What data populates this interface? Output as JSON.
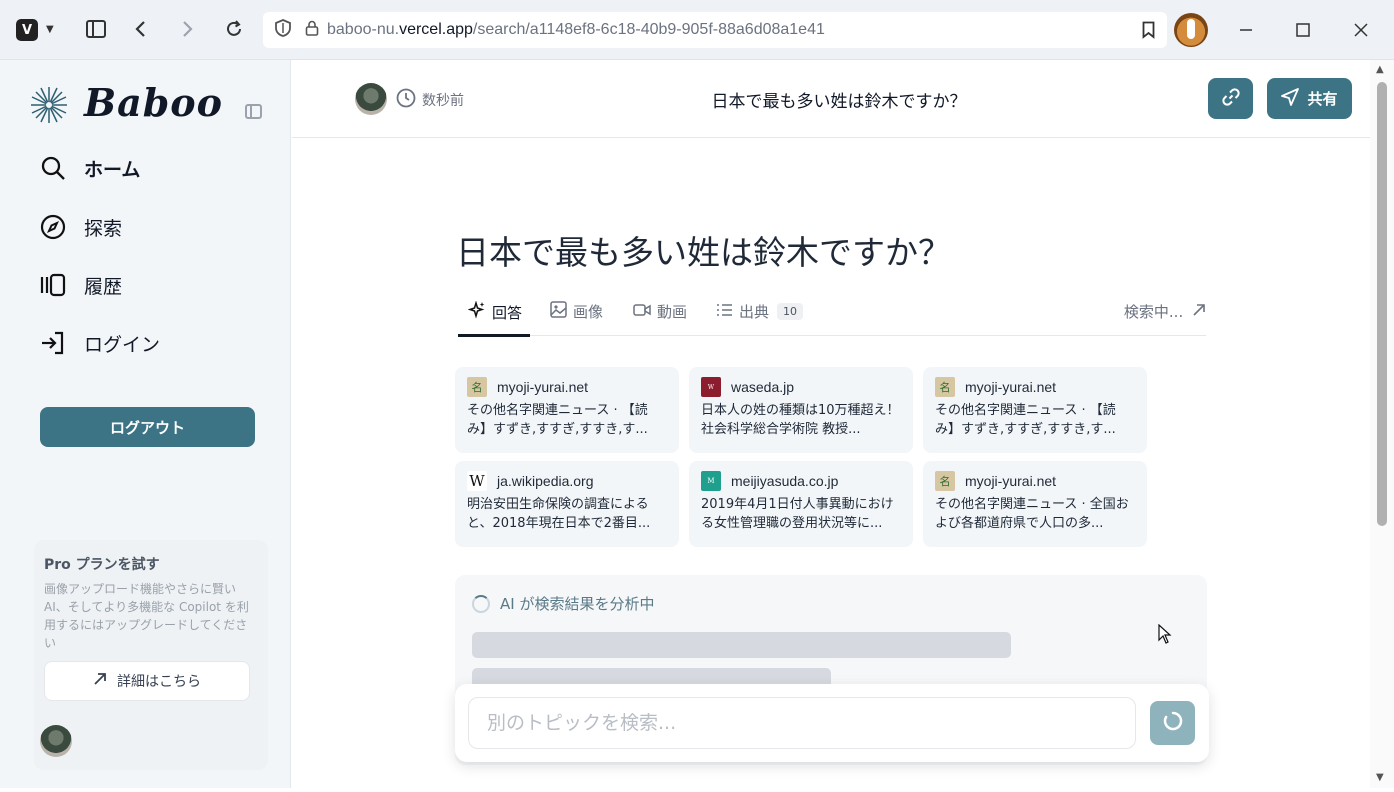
{
  "browser": {
    "url_prefix": "baboo-nu.",
    "url_host": "vercel.app",
    "url_path": "/search/a1148ef8-6c18-40b9-905f-88a6d08a1e41"
  },
  "sidebar": {
    "brand": "Baboo",
    "nav": [
      {
        "label": "ホーム",
        "icon": "search-icon"
      },
      {
        "label": "探索",
        "icon": "compass-icon"
      },
      {
        "label": "履歴",
        "icon": "history-icon"
      },
      {
        "label": "ログイン",
        "icon": "login-icon"
      }
    ],
    "logout_label": "ログアウト",
    "pro": {
      "title": "Pro プランを試す",
      "description": "画像アップロード機能やさらに賢い AI、そしてより多機能な Copilot を利用するにはアップグレードしてください",
      "button_label": "詳細はこちら"
    }
  },
  "header": {
    "time": "数秒前",
    "title": "日本で最も多い姓は鈴木ですか？",
    "share_label": "共有"
  },
  "main": {
    "question": "日本で最も多い姓は鈴木ですか？",
    "tabs": [
      {
        "label": "回答",
        "icon": "sparkle-icon"
      },
      {
        "label": "画像",
        "icon": "image-icon"
      },
      {
        "label": "動画",
        "icon": "video-icon"
      },
      {
        "label": "出典",
        "icon": "list-icon",
        "badge": "10"
      }
    ],
    "searching_label": "検索中...",
    "sources": [
      {
        "domain": "myoji-yurai.net",
        "text": "その他名字関連ニュース · 【読み】すずき,すすぎ,すすき,す...",
        "favicon": "myoji"
      },
      {
        "domain": "waseda.jp",
        "text": "日本人の姓の種類は10万種超え！ 社会科学総合学術院 教授...",
        "favicon": "waseda"
      },
      {
        "domain": "myoji-yurai.net",
        "text": "その他名字関連ニュース · 【読み】すずき,すすぎ,すすき,す...",
        "favicon": "myoji"
      },
      {
        "domain": "ja.wikipedia.org",
        "text": "明治安田生命保険の調査によると、2018年現在日本で2番目...",
        "favicon": "wikipedia"
      },
      {
        "domain": "meijiyasuda.co.jp",
        "text": "2019年4月1日付人事異動における女性管理職の登用状況等に...",
        "favicon": "meiji"
      },
      {
        "domain": "myoji-yurai.net",
        "text": "その他名字関連ニュース · 全国および各都道府県で人口の多...",
        "favicon": "myoji"
      }
    ],
    "ai_status": "AI が検索結果を分析中",
    "search_placeholder": "別のトピックを検索..."
  },
  "colors": {
    "accent": "#3c7485",
    "sidebar_bg": "#f3f6f9",
    "card_bg": "#f3f6f9"
  }
}
